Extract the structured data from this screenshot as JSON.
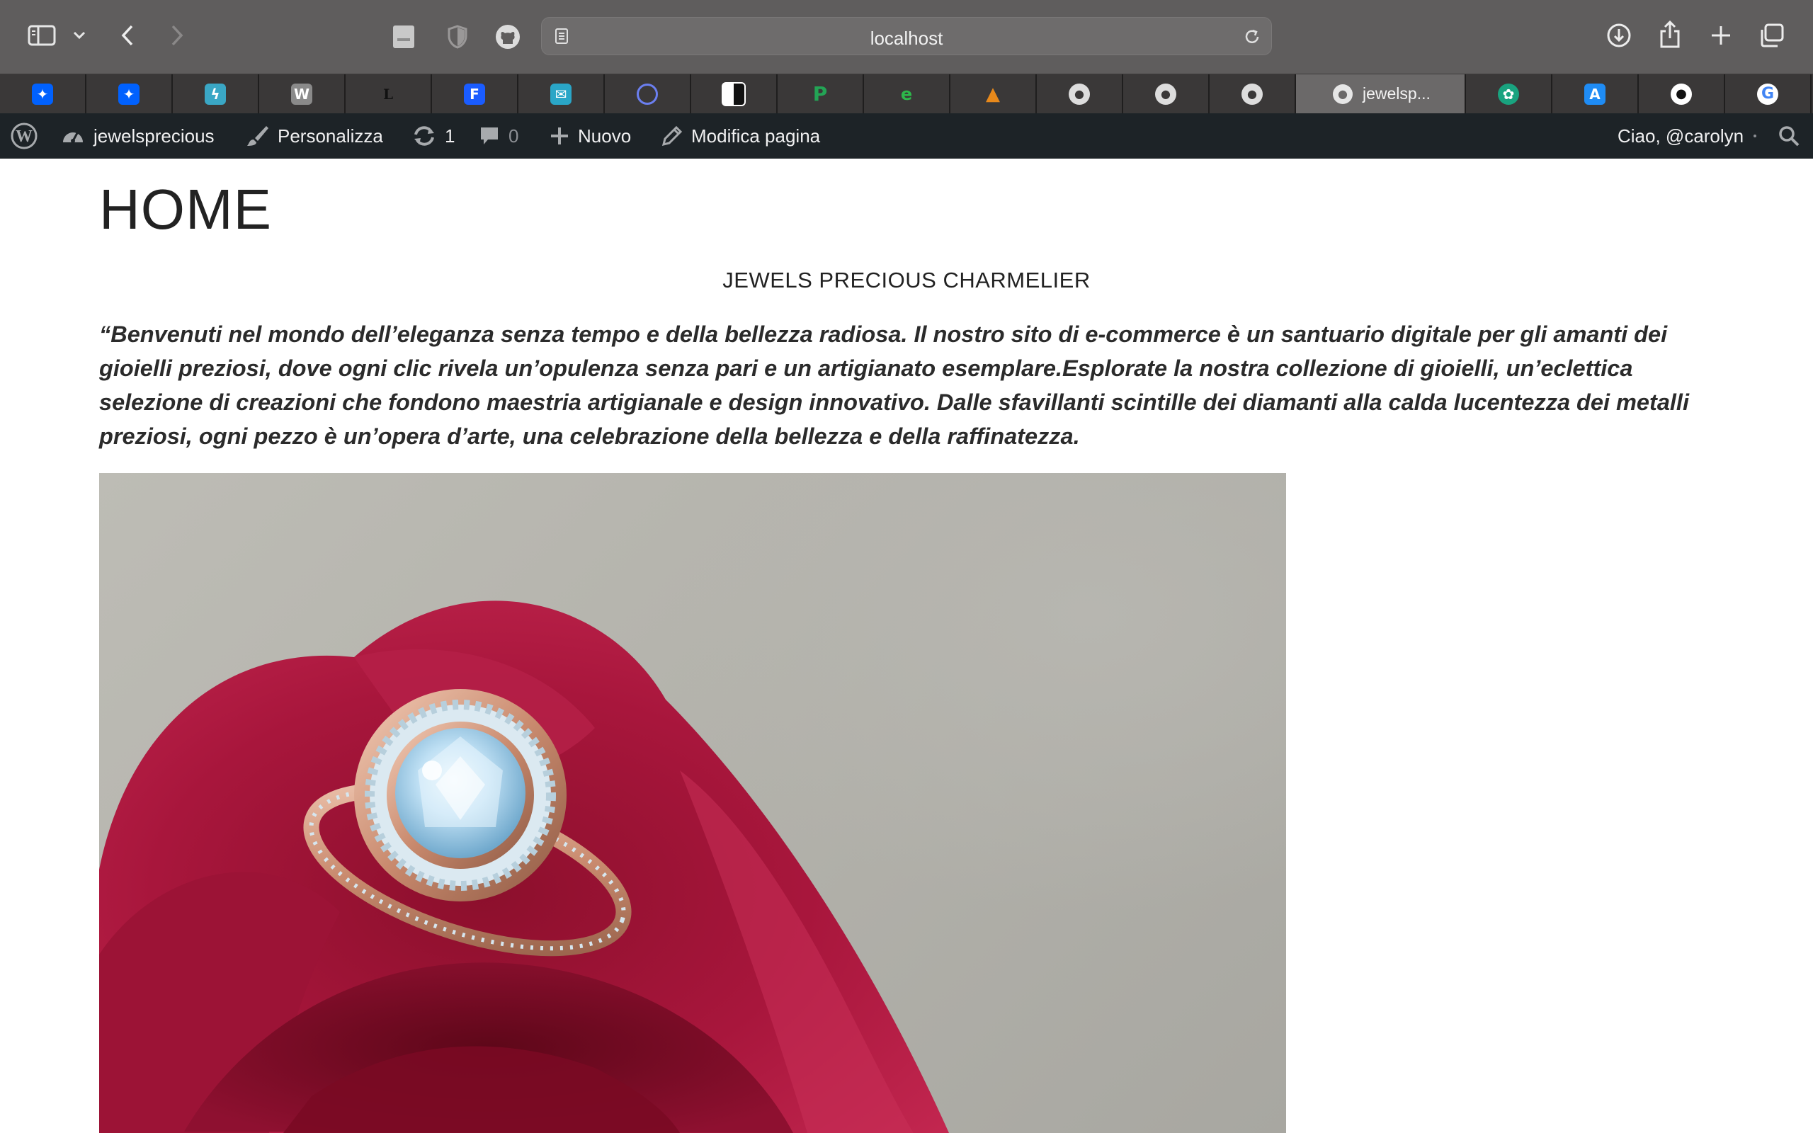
{
  "browser": {
    "url": "localhost",
    "tabs": [
      {
        "icon": "dropbox-icon",
        "color": "#0061fe"
      },
      {
        "icon": "dropbox-icon",
        "color": "#0061fe"
      },
      {
        "icon": "zapier-icon",
        "color": "#3aa7c5"
      },
      {
        "icon": "wordpress-w-icon",
        "color": "#8a8a8a"
      },
      {
        "icon": "l-letter-icon",
        "color": "#000000"
      },
      {
        "icon": "f-letter-icon",
        "color": "#1a5cff"
      },
      {
        "icon": "mail-icon",
        "color": "#2aa6c7"
      },
      {
        "icon": "circle-logo-icon",
        "color": "#4a5fd6"
      },
      {
        "icon": "checker-icon",
        "color": "#ffffff"
      },
      {
        "icon": "p-letter-icon",
        "color": "#23a455"
      },
      {
        "icon": "e-arrows-icon",
        "color": "#2db84a"
      },
      {
        "icon": "mountain-icon",
        "color": "#e8891b"
      },
      {
        "icon": "elephant-icon",
        "color": "#dddddd"
      },
      {
        "icon": "elephant-icon",
        "color": "#dddddd"
      },
      {
        "icon": "elephant-icon",
        "color": "#dddddd"
      },
      {
        "icon": "elephant-icon",
        "color": "#dddddd",
        "title": "jewelsp...",
        "active": true
      },
      {
        "icon": "openai-icon",
        "color": "#19a37f"
      },
      {
        "icon": "app-store-icon",
        "color": "#1f8cf5"
      },
      {
        "icon": "github-icon",
        "color": "#ffffff"
      },
      {
        "icon": "google-icon",
        "color": "#ffffff"
      }
    ]
  },
  "admin_bar": {
    "site_name": "jewelsprecious",
    "customize": "Personalizza",
    "updates_count": "1",
    "comments_count": "0",
    "new": "Nuovo",
    "edit_page": "Modifica pagina",
    "greeting": "Ciao, @carolyn"
  },
  "page": {
    "title": "HOME",
    "subtitle": "JEWELS PRECIOUS CHARMELIER",
    "intro": "“Benvenuti nel mondo dell’eleganza senza tempo e della bellezza radiosa. Il nostro sito di e-commerce è un santuario digitale per gli amanti dei gioielli preziosi, dove ogni clic rivela un’opulenza senza pari e un artigianato esemplare.Esplorate la nostra collezione di gioielli, un’eclettica selezione di creazioni che fondono maestria artigianale e design innovativo. Dalle sfavillanti scintille dei diamanti alla calda lucentezza dei metalli preziosi, ogni pezzo è un’opera d’arte, una celebrazione della bellezza e della raffinatezza."
  }
}
